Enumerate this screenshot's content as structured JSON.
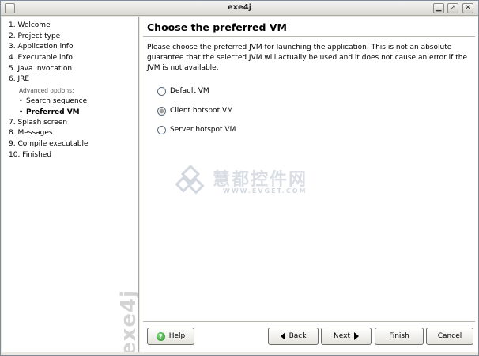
{
  "window": {
    "title": "exe4j",
    "controls": {
      "minimize_icon": "minimize-icon",
      "maximize_icon": "maximize-icon",
      "close_icon": "close-icon"
    }
  },
  "sidebar": {
    "steps": [
      {
        "label": "1. Welcome"
      },
      {
        "label": "2. Project type"
      },
      {
        "label": "3. Application info"
      },
      {
        "label": "4. Executable info"
      },
      {
        "label": "5. Java invocation"
      },
      {
        "label": "6. JRE"
      }
    ],
    "advanced_caption": "Advanced options:",
    "sub_steps": [
      {
        "label": "Search sequence",
        "active": false
      },
      {
        "label": "Preferred VM",
        "active": true
      }
    ],
    "steps_after": [
      {
        "label": "7. Splash screen"
      },
      {
        "label": "8. Messages"
      },
      {
        "label": "9. Compile executable"
      },
      {
        "label": "10. Finished"
      }
    ],
    "brand": "exe4j"
  },
  "main": {
    "heading": "Choose the preferred VM",
    "description": "Please choose the preferred JVM for launching the application. This is not an absolute guarantee that the selected JVM will actually be used and it does not cause an error if the JVM is not available.",
    "options": [
      {
        "label": "Default VM",
        "selected": false
      },
      {
        "label": "Client hotspot VM",
        "selected": true
      },
      {
        "label": "Server hotspot VM",
        "selected": false
      }
    ],
    "watermark": {
      "text": "慧都控件网",
      "url": "WWW.EVGET.COM"
    }
  },
  "footer": {
    "help_label": "Help",
    "back_label": "Back",
    "next_label": "Next",
    "finish_label": "Finish",
    "cancel_label": "Cancel"
  }
}
